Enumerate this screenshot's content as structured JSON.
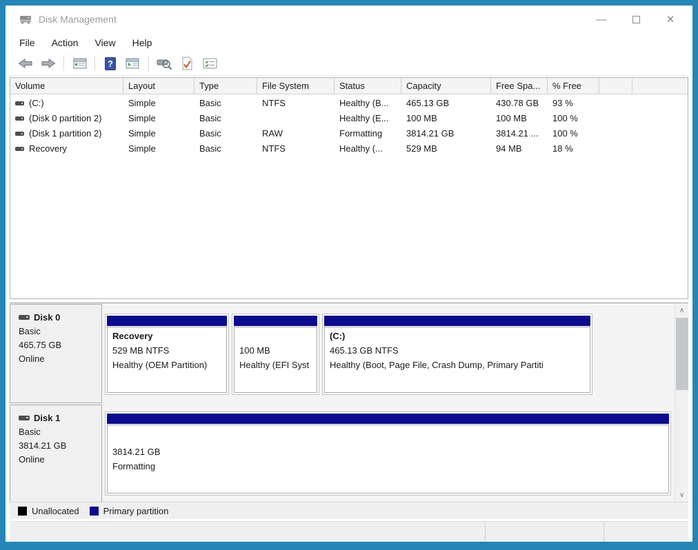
{
  "window": {
    "title": "Disk Management",
    "controls": {
      "minimize": "—",
      "close": "✕"
    }
  },
  "menu": {
    "items": [
      "File",
      "Action",
      "View",
      "Help"
    ]
  },
  "toolbar": {
    "help_glyph": "?"
  },
  "volume_list": {
    "columns": [
      "Volume",
      "Layout",
      "Type",
      "File System",
      "Status",
      "Capacity",
      "Free Spa...",
      "% Free",
      ""
    ],
    "rows": [
      {
        "volume": "(C:)",
        "layout": "Simple",
        "type": "Basic",
        "file_system": "NTFS",
        "status": "Healthy (B...",
        "capacity": "465.13 GB",
        "free_space": "430.78 GB",
        "pct_free": "93 %"
      },
      {
        "volume": "(Disk 0 partition 2)",
        "layout": "Simple",
        "type": "Basic",
        "file_system": "",
        "status": "Healthy (E...",
        "capacity": "100 MB",
        "free_space": "100 MB",
        "pct_free": "100 %"
      },
      {
        "volume": "(Disk 1 partition 2)",
        "layout": "Simple",
        "type": "Basic",
        "file_system": "RAW",
        "status": "Formatting",
        "capacity": "3814.21 GB",
        "free_space": "3814.21 ...",
        "pct_free": "100 %"
      },
      {
        "volume": "Recovery",
        "layout": "Simple",
        "type": "Basic",
        "file_system": "NTFS",
        "status": "Healthy (...",
        "capacity": "529 MB",
        "free_space": "94 MB",
        "pct_free": "18 %"
      }
    ]
  },
  "disks": [
    {
      "name": "Disk 0",
      "type": "Basic",
      "size": "465.75 GB",
      "status": "Online",
      "partitions": [
        {
          "name": "Recovery",
          "size_line": "529 MB NTFS",
          "status_line": "Healthy (OEM Partition)"
        },
        {
          "name": "",
          "size_line": "100 MB",
          "status_line": "Healthy (EFI Syst"
        },
        {
          "name": "(C:)",
          "size_line": "465.13 GB NTFS",
          "status_line": "Healthy (Boot, Page File, Crash Dump, Primary Partiti"
        }
      ]
    },
    {
      "name": "Disk 1",
      "type": "Basic",
      "size": "3814.21 GB",
      "status": "Online",
      "partitions": [
        {
          "name": "",
          "size_line": "3814.21 GB",
          "status_line": "Formatting"
        }
      ]
    }
  ],
  "legend": {
    "items": [
      {
        "label": "Unallocated",
        "color": "#000000"
      },
      {
        "label": "Primary partition",
        "color": "#0c0c8e"
      }
    ]
  },
  "scrollbar": {
    "up_glyph": "∧",
    "down_glyph": "∨"
  },
  "colors": {
    "frame": "#2585b6",
    "primary_partition": "#0c0c8e",
    "unallocated": "#000000"
  }
}
